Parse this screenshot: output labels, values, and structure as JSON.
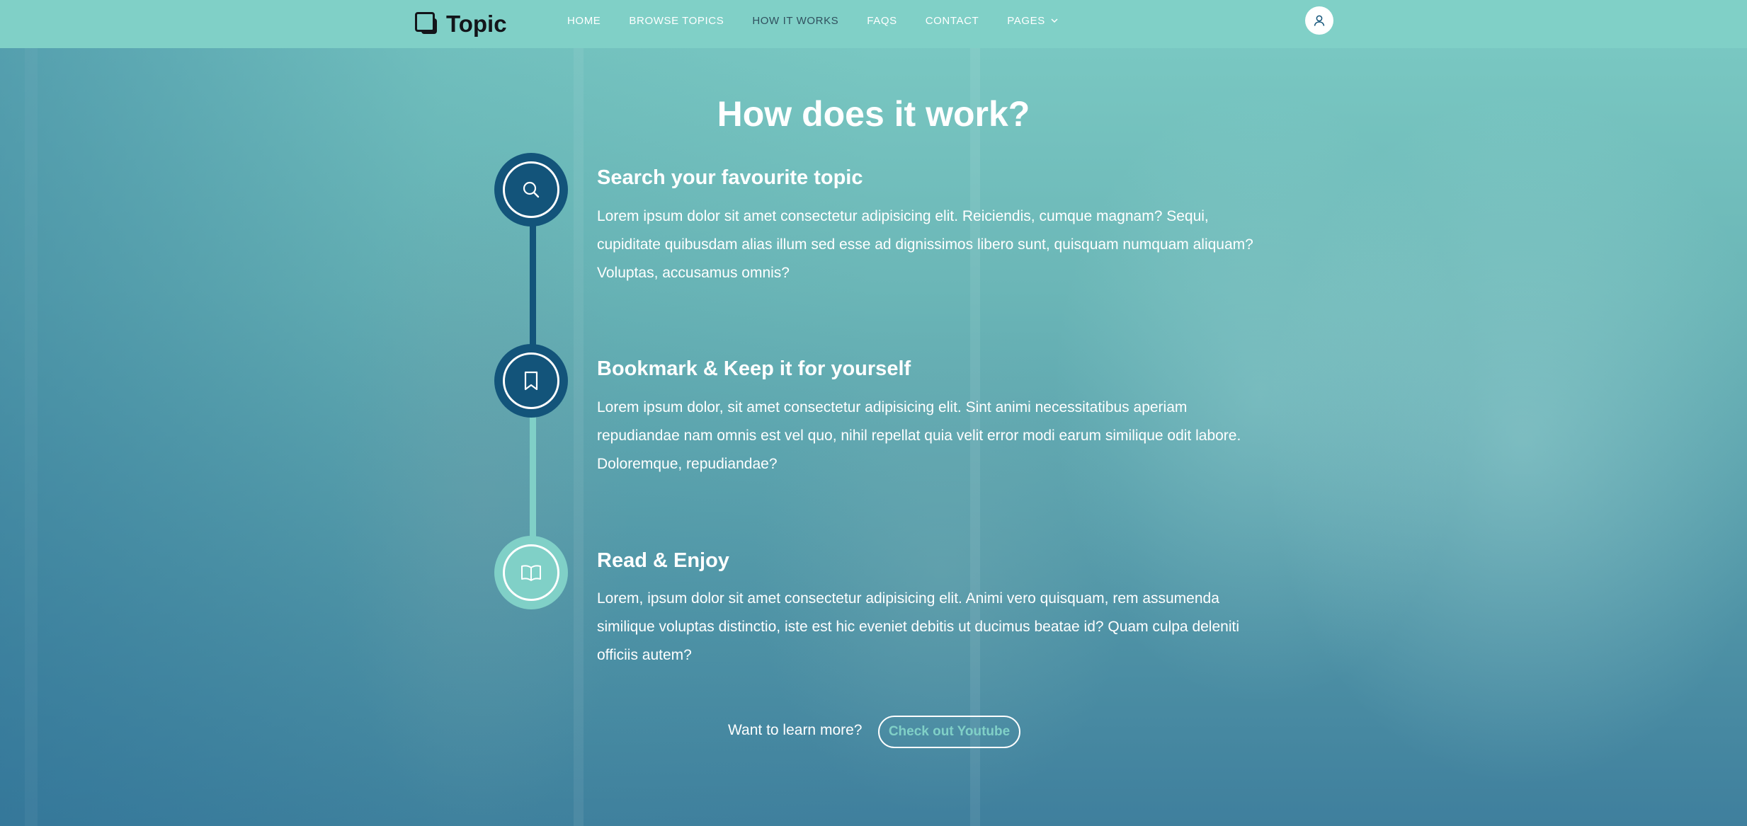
{
  "brand": {
    "name": "Topic"
  },
  "nav": {
    "links": [
      {
        "label": "HOME"
      },
      {
        "label": "BROWSE TOPICS"
      },
      {
        "label": "HOW IT WORKS"
      },
      {
        "label": "FAQS"
      },
      {
        "label": "CONTACT"
      },
      {
        "label": "PAGES"
      }
    ]
  },
  "section": {
    "title": "How does it work?",
    "steps": [
      {
        "title": "Search your favourite topic",
        "text": "Lorem ipsum dolor sit amet consectetur adipisicing elit. Reiciendis, cumque magnam? Sequi, cupiditate quibusdam alias illum sed esse ad dignissimos libero sunt, quisquam numquam aliquam? Voluptas, accusamus omnis?",
        "icon": "search-icon"
      },
      {
        "title": "Bookmark & Keep it for yourself",
        "text": "Lorem ipsum dolor, sit amet consectetur adipisicing elit. Sint animi necessitatibus aperiam repudiandae nam omnis est vel quo, nihil repellat quia velit error modi earum similique odit labore. Doloremque, repudiandae?",
        "icon": "bookmark-icon"
      },
      {
        "title": "Read & Enjoy",
        "text": "Lorem, ipsum dolor sit amet consectetur adipisicing elit. Animi vero quisquam, rem assumenda similique voluptas distinctio, iste est hic eveniet debitis ut ducimus beatae id? Quam culpa deleniti officiis autem?",
        "icon": "book-icon"
      }
    ]
  },
  "cta": {
    "text": "Want to learn more?",
    "button": "Check out Youtube"
  },
  "colors": {
    "navbar": "#80d0c7",
    "primary": "#13547a",
    "secondary": "#80d0c7",
    "text": "#ffffff"
  }
}
